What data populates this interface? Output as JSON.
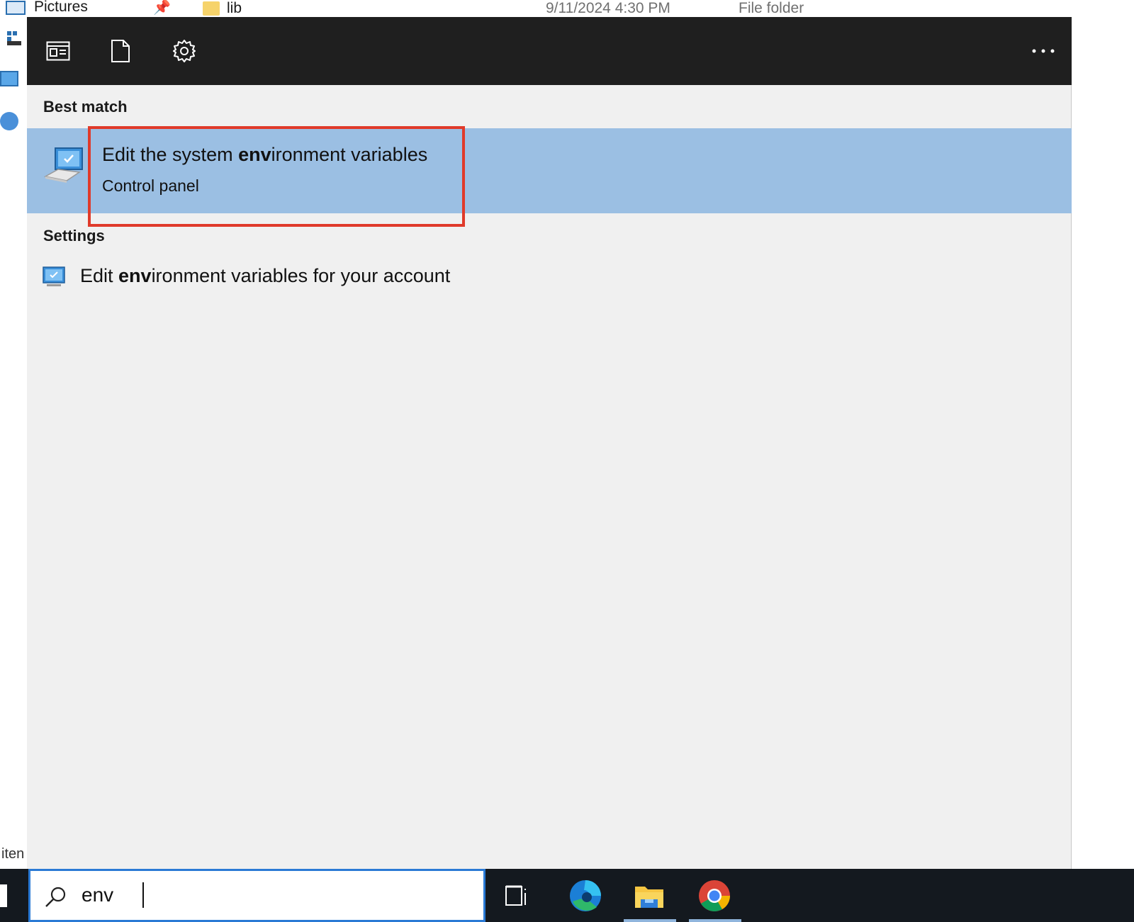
{
  "explorer": {
    "pictures_label": "Pictures",
    "folder_name": "lib",
    "folder_date": "9/11/2024 4:30 PM",
    "folder_type": "File folder",
    "status_text": "iten"
  },
  "flyout": {
    "header": {
      "apps_icon": "apps-icon",
      "documents_icon": "document-icon",
      "settings_icon": "gear-icon",
      "more_label": "···"
    },
    "best_match": {
      "section_label": "Best match",
      "title_prefix": "Edit the system ",
      "title_bold": "env",
      "title_suffix": "ironment variables",
      "subtitle": "Control panel"
    },
    "settings": {
      "section_label": "Settings",
      "item_prefix": "Edit ",
      "item_bold": "env",
      "item_suffix": "ironment variables for your account"
    }
  },
  "taskbar": {
    "search_value": "env",
    "apps": [
      "task-view-icon",
      "edge-icon",
      "file-explorer-icon",
      "chrome-icon"
    ]
  },
  "colors": {
    "header_bg": "#1f1f1f",
    "flyout_bg": "#f0f0f0",
    "selected_bg": "#9bbfe3",
    "highlight_border": "#e03a2a",
    "taskbar_bg": "#14191f",
    "search_border": "#2a7ad5"
  }
}
